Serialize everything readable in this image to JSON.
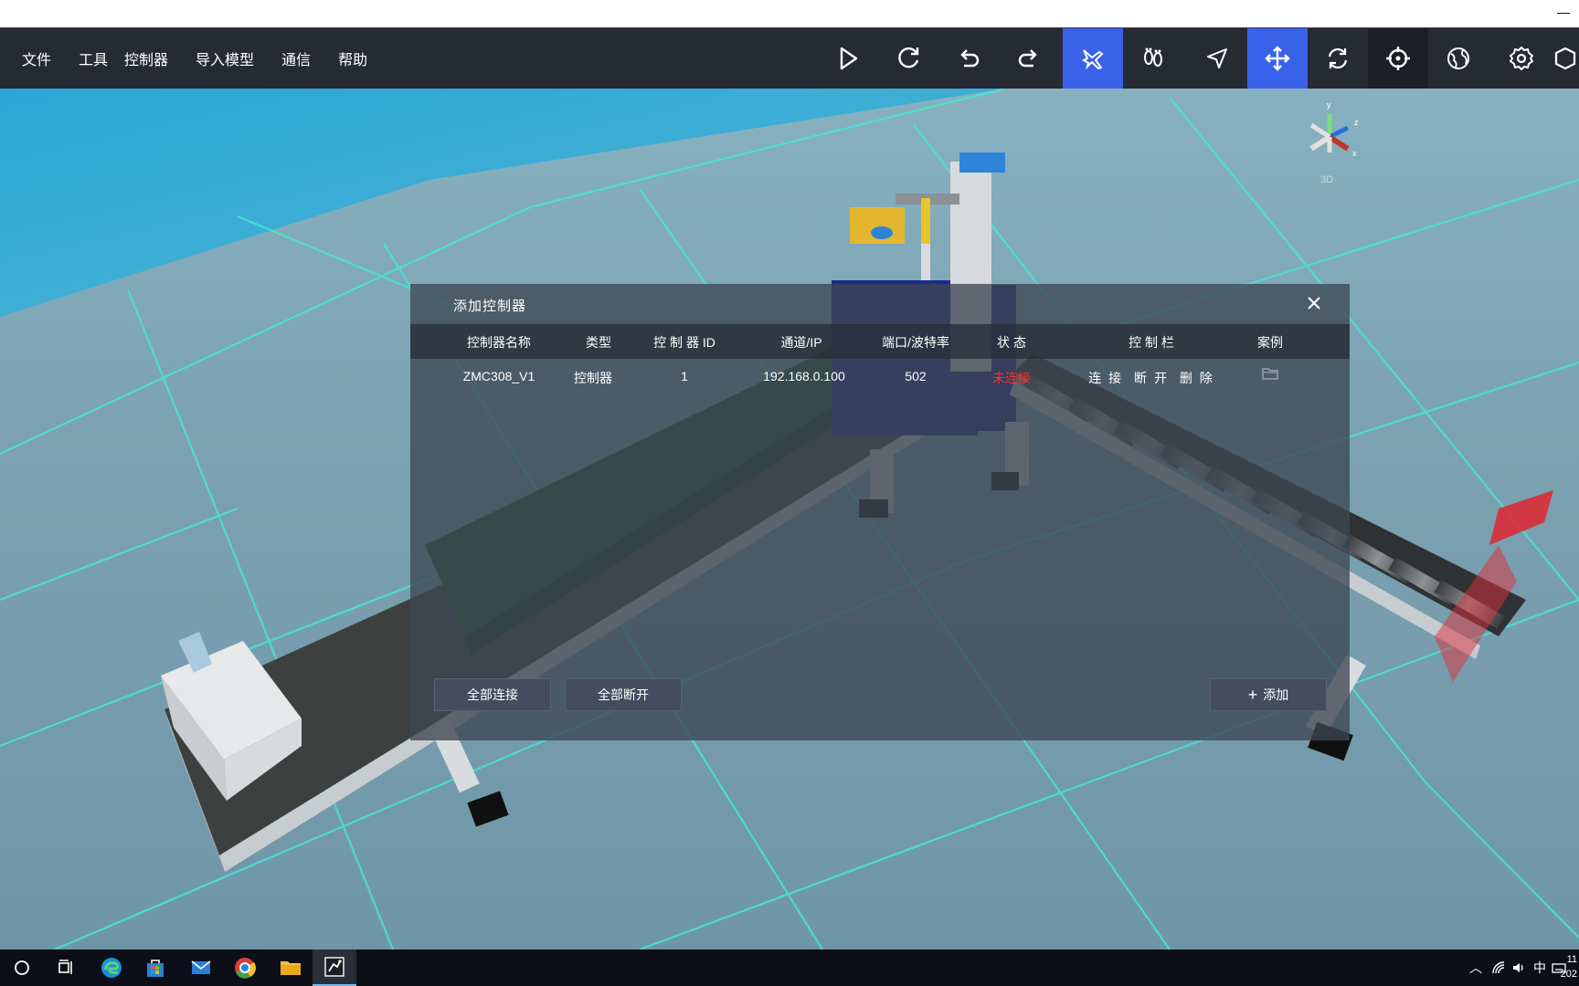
{
  "menu": [
    "文件",
    "工具",
    "控制器",
    "导入模型",
    "通信",
    "帮助"
  ],
  "toolbar": {
    "buttons": [
      "play-icon",
      "refresh-icon",
      "undo-icon",
      "redo-icon",
      "plane-icon",
      "footprints-icon",
      "pointer-icon",
      "move-icon",
      "sync-icon",
      "crosshair-icon",
      "globe-icon",
      "settings-icon"
    ],
    "active": [
      "plane-icon",
      "move-icon"
    ],
    "accent_color": "#3a62e8"
  },
  "gizmo": {
    "label": "3D",
    "axes": [
      "y",
      "z",
      "x"
    ]
  },
  "dialog": {
    "title": "添加控制器",
    "columns": [
      "控制器名称",
      "类型",
      "控 制 器 ID",
      "通道/IP",
      "端口/波特率",
      "状 态",
      "控 制 栏",
      "案例"
    ],
    "rows": [
      {
        "name": "ZMC308_V1",
        "type": "控制器",
        "id": "1",
        "ip": "192.168.0.100",
        "port": "502",
        "status": "未连接",
        "actions": [
          "连 接",
          "断 开",
          "删 除"
        ]
      }
    ],
    "buttons": {
      "connect_all": "全部连接",
      "disconnect_all": "全部断开",
      "add": "添加"
    },
    "status_off_color": "#ff2b2b"
  },
  "taskbar": {
    "apps": [
      "search-icon",
      "task-view-icon",
      "edge-icon",
      "store-icon",
      "mail-icon",
      "chrome-icon",
      "explorer-icon",
      "simulator-icon"
    ],
    "active_app": "simulator-icon",
    "ime": "中",
    "clock": [
      "11",
      "202"
    ]
  }
}
